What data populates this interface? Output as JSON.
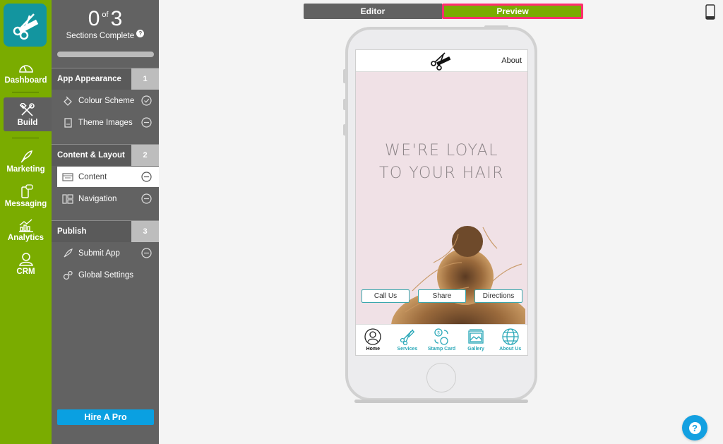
{
  "leftnav": {
    "logo": "scissors-comb-logo",
    "items": [
      {
        "label": "Dashboard",
        "icon": "gauge-icon"
      },
      {
        "label": "Build",
        "icon": "tools-icon",
        "active": true
      },
      {
        "label": "Marketing",
        "icon": "rocket-icon"
      },
      {
        "label": "Messaging",
        "icon": "phone-chat-icon"
      },
      {
        "label": "Analytics",
        "icon": "chart-icon"
      },
      {
        "label": "CRM",
        "icon": "person-icon"
      }
    ]
  },
  "progress": {
    "completed": "0",
    "of_label": "of",
    "total": "3",
    "label": "Sections Complete",
    "help": "?",
    "fraction": 0
  },
  "sections": [
    {
      "title": "App Appearance",
      "number": "1",
      "items": [
        {
          "label": "Colour Scheme",
          "icon": "paint-bucket-icon",
          "status": "check"
        },
        {
          "label": "Theme Images",
          "icon": "image-file-icon",
          "status": "minus"
        }
      ]
    },
    {
      "title": "Content & Layout",
      "number": "2",
      "items": [
        {
          "label": "Content",
          "icon": "content-icon",
          "status": "minus",
          "active": true
        },
        {
          "label": "Navigation",
          "icon": "layout-icon",
          "status": "minus"
        }
      ]
    },
    {
      "title": "Publish",
      "number": "3",
      "items": [
        {
          "label": "Submit App",
          "icon": "rocket-icon",
          "status": "minus"
        },
        {
          "label": "Global Settings",
          "icon": "gears-icon",
          "status": "none"
        }
      ]
    }
  ],
  "hire_button": "Hire A Pro",
  "toggle": {
    "editor": "Editor",
    "preview": "Preview",
    "active": "preview"
  },
  "colors": {
    "brand_green": "#7aac00",
    "panel_gray": "#626262",
    "accent_blue": "#0aa0e1",
    "highlight_pink": "#ff2e6d",
    "teal": "#2aa8b8"
  },
  "preview": {
    "header_link": "About",
    "headline_line1": "WE'RE LOYAL",
    "headline_line2": "TO YOUR HAIR",
    "buttons": [
      "Call Us",
      "Share",
      "Directions"
    ],
    "tabs": [
      {
        "label": "Home",
        "icon": "user-circle-icon",
        "active": true
      },
      {
        "label": "Services",
        "icon": "scissors-icon"
      },
      {
        "label": "Stamp Card",
        "icon": "stamp-card-icon"
      },
      {
        "label": "Gallery",
        "icon": "gallery-icon"
      },
      {
        "label": "About Us",
        "icon": "globe-icon"
      }
    ]
  },
  "help_button": "?"
}
